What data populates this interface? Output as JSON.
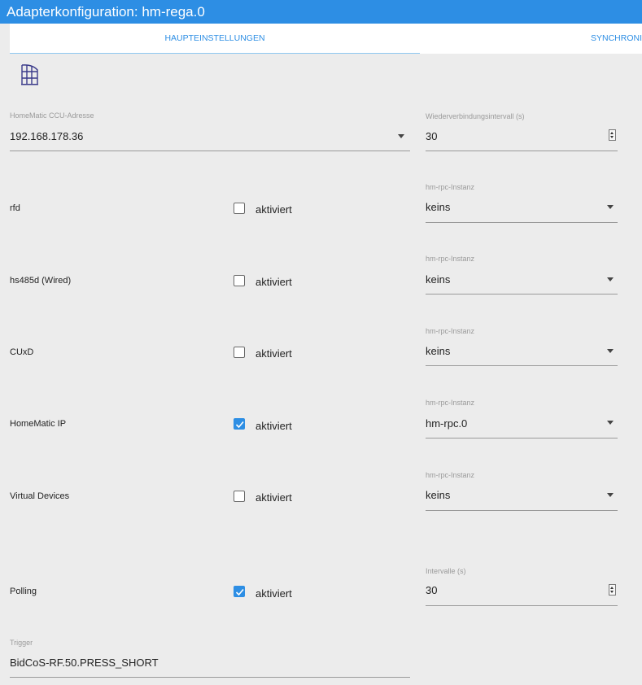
{
  "window": {
    "title": "Adapterkonfiguration: hm-rega.0"
  },
  "tabs": [
    {
      "label": "HAUPTEINSTELLUNGEN",
      "active": true
    },
    {
      "label": "SYNCHRONIS",
      "active": false
    }
  ],
  "logo": {
    "caption": "HomeMatic"
  },
  "ccu": {
    "label": "HomeMatic CCU-Adresse",
    "value": "192.168.178.36"
  },
  "reconnect": {
    "label": "Wiederverbindungsintervall (s)",
    "value": "30"
  },
  "checkbox_text": "aktiviert",
  "rows": [
    {
      "name": "rfd",
      "checked": false,
      "instance_label": "hm-rpc-Instanz",
      "instance_value": "keins"
    },
    {
      "name": "hs485d (Wired)",
      "checked": false,
      "instance_label": "hm-rpc-Instanz",
      "instance_value": "keins"
    },
    {
      "name": "CUxD",
      "checked": false,
      "instance_label": "hm-rpc-Instanz",
      "instance_value": "keins"
    },
    {
      "name": "HomeMatic IP",
      "checked": true,
      "instance_label": "hm-rpc-Instanz",
      "instance_value": "hm-rpc.0"
    },
    {
      "name": "Virtual Devices",
      "checked": false,
      "instance_label": "hm-rpc-Instanz",
      "instance_value": "keins"
    }
  ],
  "polling": {
    "name": "Polling",
    "checked": true,
    "interval_label": "Intervalle (s)",
    "interval_value": "30"
  },
  "trigger": {
    "label": "Trigger",
    "value": "BidCoS-RF.50.PRESS_SHORT"
  },
  "colors": {
    "accent": "#2d8ee4",
    "background": "#ececec"
  }
}
